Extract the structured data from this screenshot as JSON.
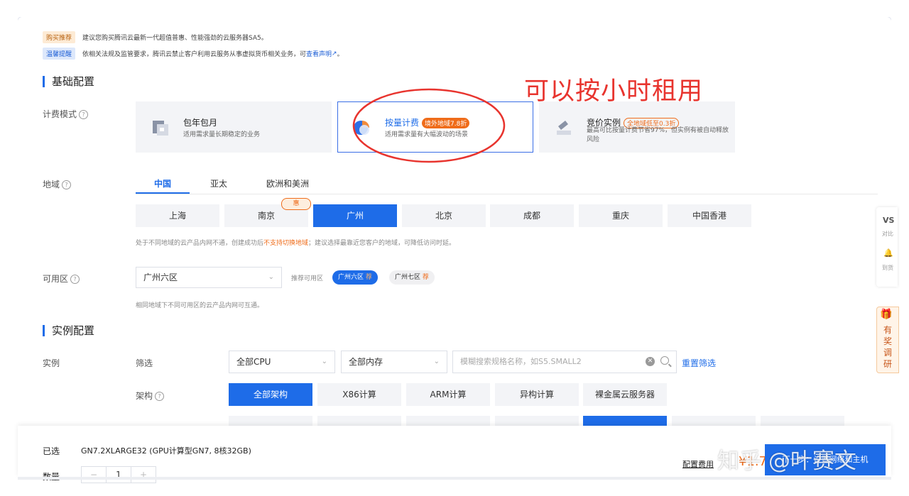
{
  "notices": [
    {
      "tag": "购买推荐",
      "text": "建议您购买腾讯云最新一代超值普惠、性能强劲的云服务器SA5。",
      "link": ""
    },
    {
      "tag": "温馨提醒",
      "text": "依相关法规及监管要求，腾讯云禁止客户利用云服务从事虚拟货币相关业务，可",
      "link": "查看声明",
      "suffix": "。"
    }
  ],
  "sections": {
    "basic": "基础配置",
    "instance": "实例配置"
  },
  "labels": {
    "billing": "计费模式",
    "region": "地域",
    "zone": "可用区",
    "instance": "实例",
    "filter": "筛选",
    "arch": "架构"
  },
  "billing_cards": [
    {
      "title": "包年包月",
      "badge": "",
      "desc": "适用需求量长期稳定的业务",
      "active": false
    },
    {
      "title": "按量计费",
      "badge": "境外地域7.8折",
      "desc": "适用需求量有大幅波动的场景",
      "active": true
    },
    {
      "title": "竞价实例",
      "badge": "全地域低至0.3折",
      "desc": "最高可比按量计费节省97%，但实例有被自动释放风险",
      "active": false
    }
  ],
  "region_tabs": [
    "中国",
    "亚太",
    "欧洲和美洲"
  ],
  "cities": [
    "上海",
    "南京",
    "广州",
    "北京",
    "成都",
    "重庆",
    "中国香港"
  ],
  "active_city": "广州",
  "hui_badge": "惠",
  "region_hint": {
    "pre": "处于不同地域的云产品内网不通，创建成功后",
    "warn": "不支持切换地域",
    "post": "；建议选择最靠近您客户的地域，可降低访问时延。"
  },
  "zone": {
    "selected": "广州六区",
    "recommend_label": "推荐可用区",
    "pills": [
      {
        "name": "广州六区",
        "rec": "荐"
      },
      {
        "name": "广州七区",
        "rec": "荐"
      }
    ],
    "hint": "相同地域下不同可用区的云产品内网可互通。"
  },
  "filters": {
    "cpu": "全部CPU",
    "mem": "全部内存",
    "search_placeholder": "模糊搜索规格名称，如S5.SMALL2",
    "reset": "重置筛选"
  },
  "archs": [
    "全部架构",
    "X86计算",
    "ARM计算",
    "异构计算",
    "裸金属云服务器"
  ],
  "bottom": {
    "selected_label": "已选",
    "selected_value": "GN7.2XLARGE32 (GPU计算型GN7, 8核32GB)",
    "qty_label": "数量",
    "qty": "1",
    "minus": "−",
    "plus": "+",
    "fee_label": "配置费用",
    "fee_value": "¥1.79",
    "next": "下一步：设置网络和主机"
  },
  "side": {
    "a": "VS",
    "b": "对比",
    "c": "🔔",
    "d": "到货",
    "gift": "🎁",
    "survey": "有奖调研"
  },
  "annotation": "可以按小时租用",
  "watermark": "知乎 @叶赛文",
  "colors": {
    "primary": "#1e6ce8",
    "orange": "#ef6c1a",
    "annotation": "#e8342e"
  }
}
